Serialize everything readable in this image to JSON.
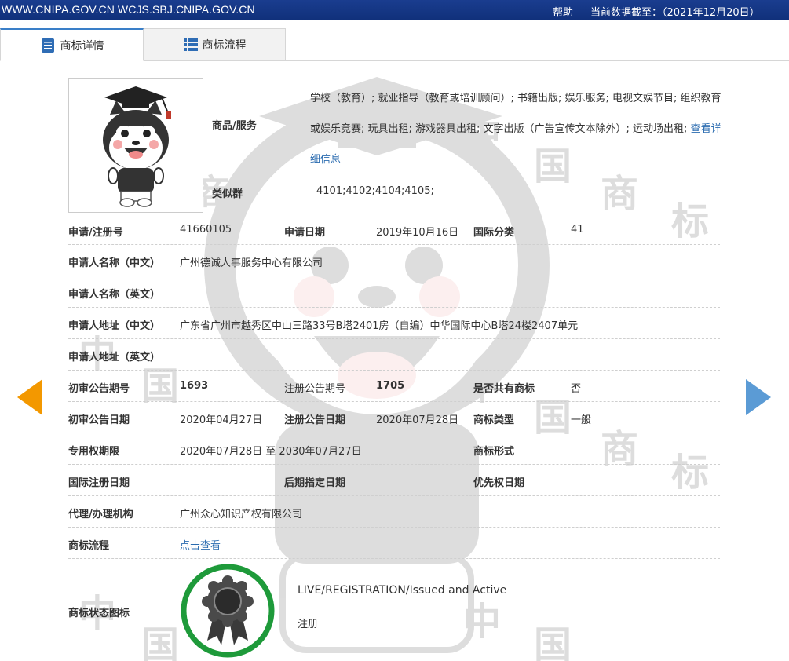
{
  "topbar": {
    "site_urls": "WWW.CNIPA.GOV.CN WCJS.SBJ.CNIPA.GOV.CN",
    "help_label": "帮助",
    "data_as_of": "当前数据截至：（2021年12月20日）"
  },
  "tabs": [
    {
      "label": "商标详情",
      "icon": "document-icon",
      "active": true
    },
    {
      "label": "商标流程",
      "icon": "list-icon",
      "active": false
    }
  ],
  "goods": {
    "label": "商品/服务",
    "text": "学校（教育）; 就业指导（教育或培训顾问）; 书籍出版; 娱乐服务; 电视文娱节目; 组织教育或娱乐竞赛; 玩具出租; 游戏器具出租; 文字出版（广告宣传文本除外）; 运动场出租;",
    "detail_link": "查看详细信息"
  },
  "similar_group": {
    "label": "类似群",
    "value": "4101;4102;4104;4105;"
  },
  "rows": [
    {
      "cells": [
        {
          "label": "申请/注册号",
          "value": "41660105"
        },
        {
          "label": "申请日期",
          "value": "2019年10月16日"
        },
        {
          "label": "国际分类",
          "value": "41"
        }
      ]
    },
    {
      "cells": [
        {
          "label": "申请人名称（中文）",
          "value": "广州德诚人事服务中心有限公司"
        }
      ]
    },
    {
      "cells": [
        {
          "label": "申请人名称（英文）",
          "value": ""
        }
      ]
    },
    {
      "cells": [
        {
          "label": "申请人地址（中文）",
          "value": "广东省广州市越秀区中山三路33号B塔2401房（自编）中华国际中心B塔24楼2407单元"
        }
      ]
    },
    {
      "cells": [
        {
          "label": "申请人地址（英文）",
          "value": ""
        }
      ]
    },
    {
      "cells": [
        {
          "label": "初审公告期号",
          "value": "1693"
        },
        {
          "label": "注册公告期号",
          "value": "1705"
        },
        {
          "label": "是否共有商标",
          "value": "否"
        }
      ]
    },
    {
      "cells": [
        {
          "label": "初审公告日期",
          "value": "2020年04月27日"
        },
        {
          "label": "注册公告日期",
          "value": "2020年07月28日"
        },
        {
          "label": "商标类型",
          "value": "一般"
        }
      ]
    },
    {
      "cells": [
        {
          "label": "专用权期限",
          "value": "2020年07月28日 至 2030年07月27日"
        },
        {
          "label": "",
          "value": ""
        },
        {
          "label": "商标形式",
          "value": ""
        }
      ]
    },
    {
      "cells": [
        {
          "label": "国际注册日期",
          "value": ""
        },
        {
          "label": "后期指定日期",
          "value": ""
        },
        {
          "label": "优先权日期",
          "value": ""
        }
      ]
    },
    {
      "cells": [
        {
          "label": "代理/办理机构",
          "value": "广州众心知识产权有限公司"
        }
      ]
    },
    {
      "cells": [
        {
          "label": "商标流程",
          "value": "点击查看"
        }
      ]
    }
  ],
  "status": {
    "label": "商标状态图标",
    "english": "LIVE/REGISTRATION/Issued and Active",
    "chinese": "注册",
    "icon": "rosette-badge-icon"
  },
  "watermark_text": "中国商标",
  "colors": {
    "topbar": "#10307a",
    "link": "#2b6cb0",
    "prev_arrow": "#f39800",
    "next_arrow": "#5b9bd5",
    "status_ring": "#1e9a3a"
  }
}
